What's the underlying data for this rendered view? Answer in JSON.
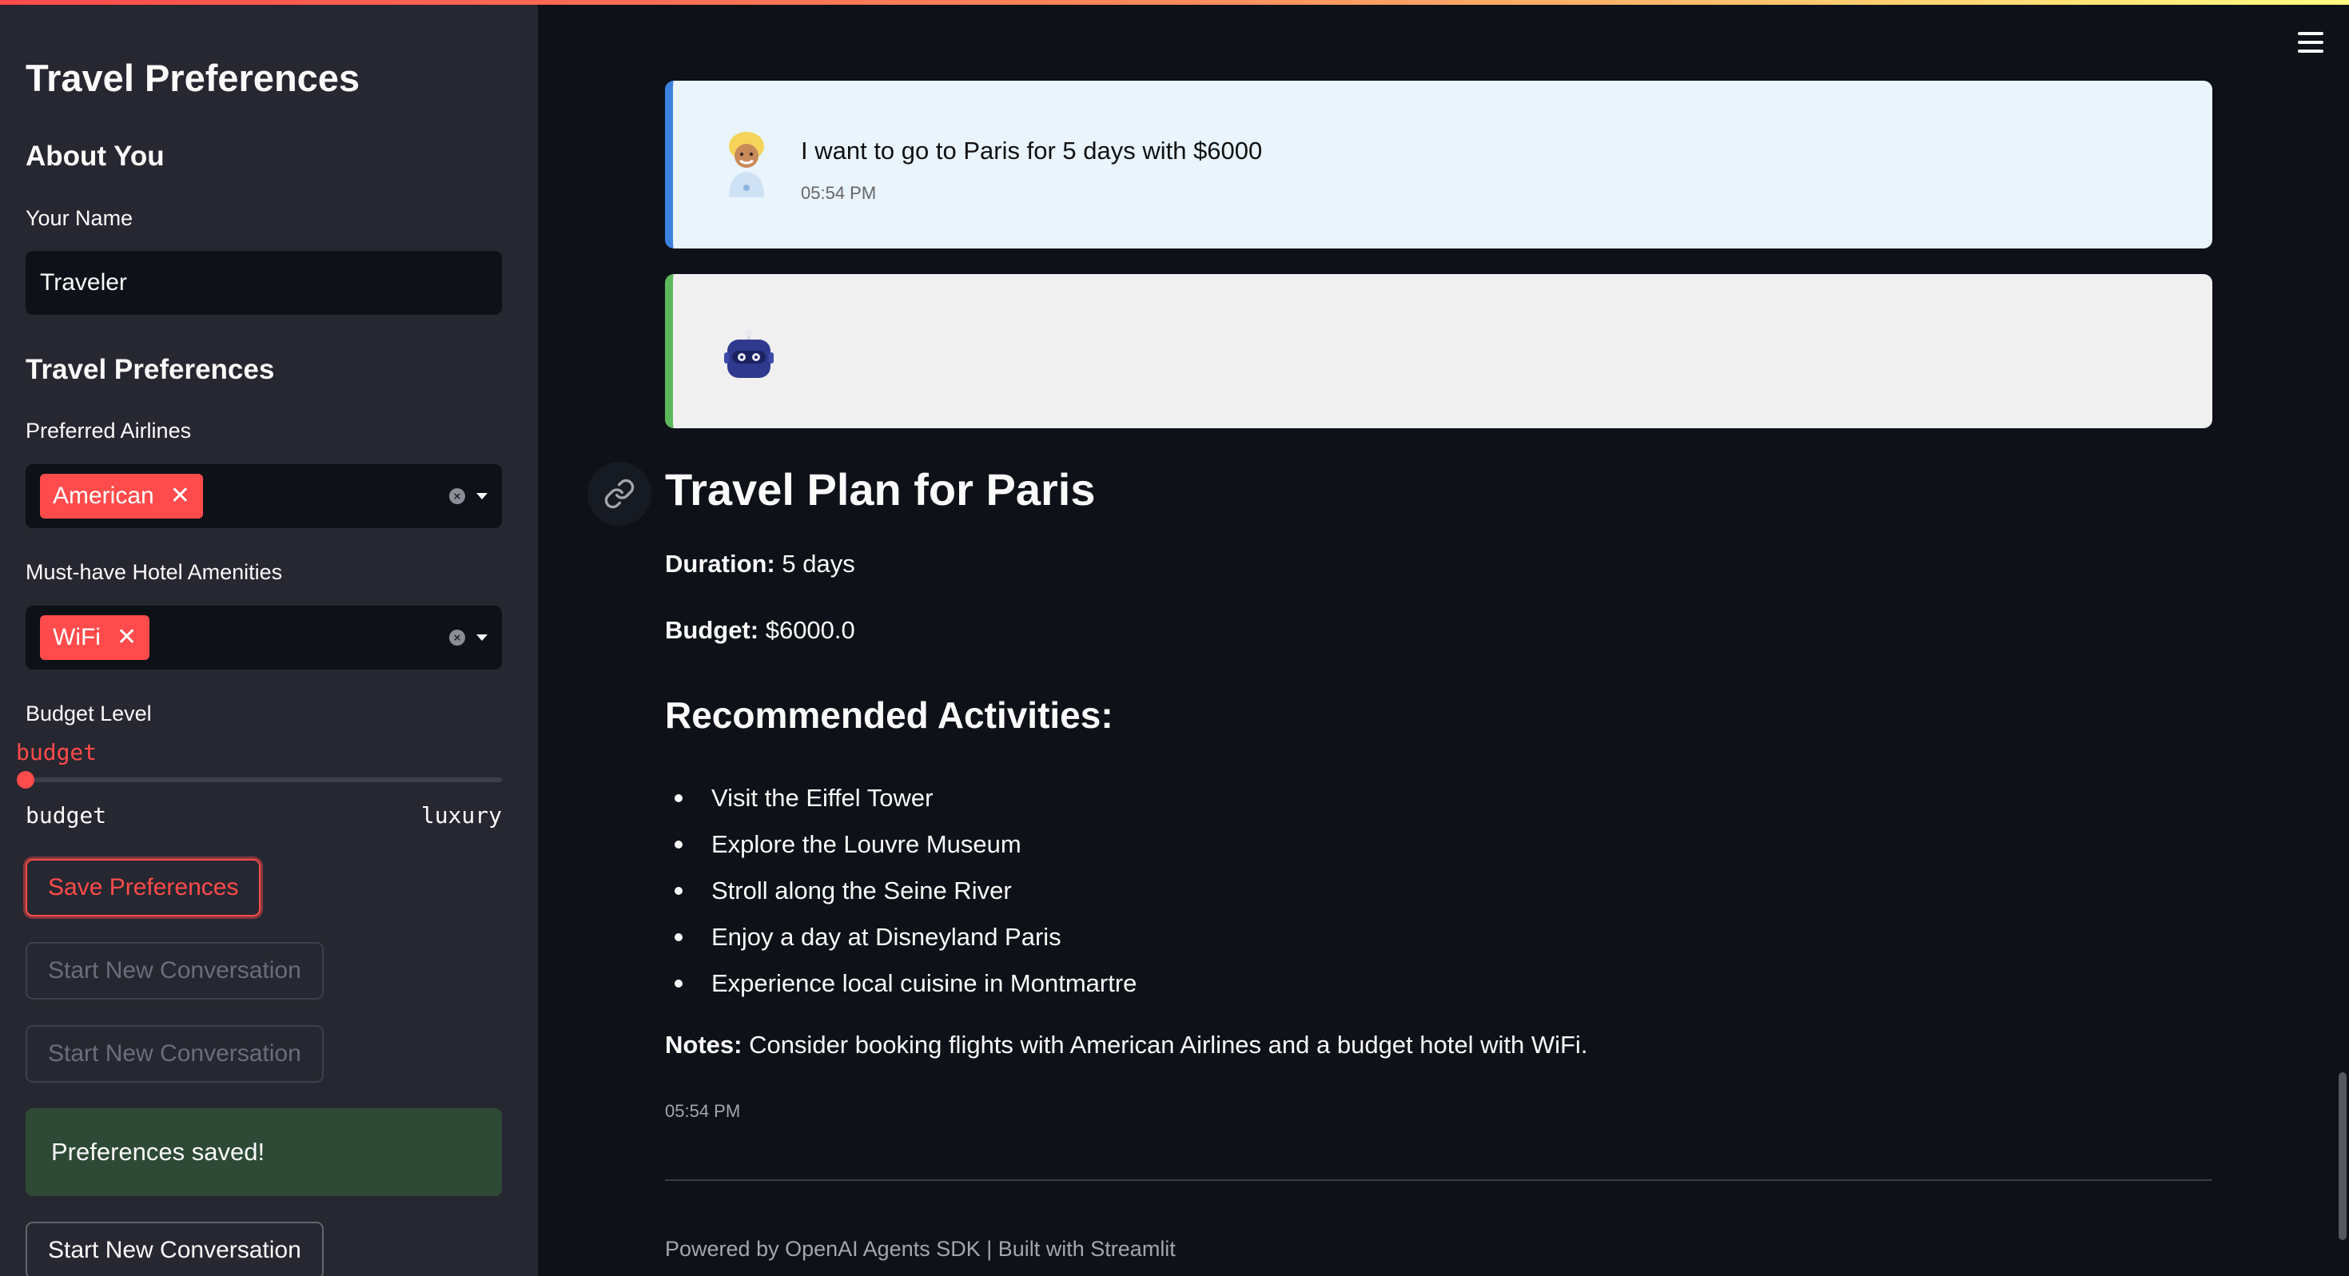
{
  "sidebar": {
    "title": "Travel Preferences",
    "about_heading": "About You",
    "name_label": "Your Name",
    "name_value": "Traveler",
    "prefs_heading": "Travel Preferences",
    "airlines_label": "Preferred Airlines",
    "airlines_selected": "American",
    "amenities_label": "Must-have Hotel Amenities",
    "amenities_selected": "WiFi",
    "budget_label": "Budget Level",
    "budget_value": "budget",
    "budget_min": "budget",
    "budget_max": "luxury",
    "budget_level": 0,
    "save_button": "Save Preferences",
    "new_conv_disabled_1": "Start New Conversation",
    "new_conv_disabled_2": "Start New Conversation",
    "success_message": "Preferences saved!",
    "new_conv_button": "Start New Conversation"
  },
  "chat": {
    "user_message": "I want to go to Paris for 5 days with $6000",
    "user_time": "05:54 PM"
  },
  "plan": {
    "title": "Travel Plan for Paris",
    "duration_label": "Duration:",
    "duration_value": " 5 days",
    "budget_label": "Budget:",
    "budget_value": " $6000.0",
    "activities_heading": "Recommended Activities:",
    "activities": [
      "Visit the Eiffel Tower",
      "Explore the Louvre Museum",
      "Stroll along the Seine River",
      "Enjoy a day at Disneyland Paris",
      "Experience local cuisine in Montmartre"
    ],
    "notes_label": "Notes:",
    "notes_value": " Consider booking flights with American Airlines and a budget hotel with WiFi.",
    "time": "05:54 PM"
  },
  "footer": "Powered by OpenAI Agents SDK | Built with Streamlit",
  "colors": {
    "accent": "#ff4b4b",
    "background": "#0e1117",
    "sidebar": "#262730",
    "success_bg": "#2e4a36",
    "user_bubble": "#e9f4fd",
    "bot_bubble": "#f0f0f0"
  },
  "icons": [
    "menu-icon",
    "user-avatar-icon",
    "bot-avatar-icon",
    "link-icon",
    "clear-icon",
    "chevron-down-icon",
    "close-icon"
  ]
}
